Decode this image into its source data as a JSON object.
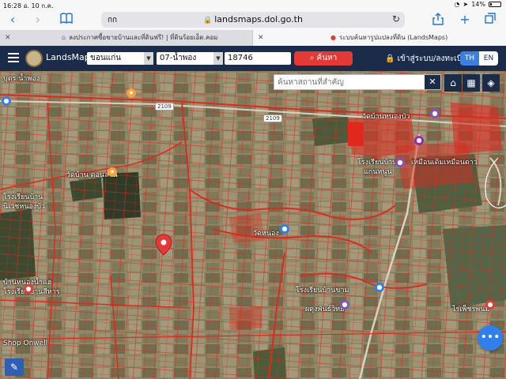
{
  "status_bar": {
    "time": "16:28",
    "date": "อ. 10 ก.ค.",
    "battery": "14%"
  },
  "browser": {
    "text_size_label": "กก",
    "url": "landsmaps.dol.go.th",
    "tabs": [
      {
        "title": "ลงประกาศซื้อขายบ้านและที่ดินฟรี! | ที่ดินร้อยเอ็ด.คอม",
        "active": false
      },
      {
        "title": "ระบบค้นหารูปแปลงที่ดิน (LandsMaps)",
        "active": true
      }
    ]
  },
  "header": {
    "brand": "LandsMaps",
    "province": "ขอนแก่น",
    "district": "07-น้ำพอง",
    "parcel_number": "18746",
    "search_label": "ค้นหา",
    "login_label": "เข้าสู่ระบบ/ลงทะเบียน",
    "lang_th": "TH",
    "lang_en": "EN"
  },
  "map": {
    "search_placeholder": "ค้นหาสถานที่สำคัญ",
    "road_labels": [
      "2109",
      "2109"
    ],
    "place_labels": [
      "บุตร น้ำพอง",
      "วัดบ้านหนองบัว",
      "วัดบ้าน ดอนลาน",
      "โรงเรียนบ้าน",
      "แก่นหนูน",
      "วัดหนอง",
      "โรงเรียนบ้าน",
      "นิเวชหนองบัว",
      "บ้านหนองน้ำแฮ",
      "โรงเรียนบ้านขาม",
      "ผดุงพันธ์วิทย์",
      "โรงเรียนบ้านสีหาร",
      "เหมือนเดิมเหมือนดาว",
      "ไร่เพ็ชรพนม",
      "Shop Onwell"
    ],
    "colors": {
      "parcel_boundary": "#e0281e",
      "marker": "#e53935",
      "header_bg": "#1b2c4a",
      "accent_blue": "#2f80ed"
    }
  }
}
